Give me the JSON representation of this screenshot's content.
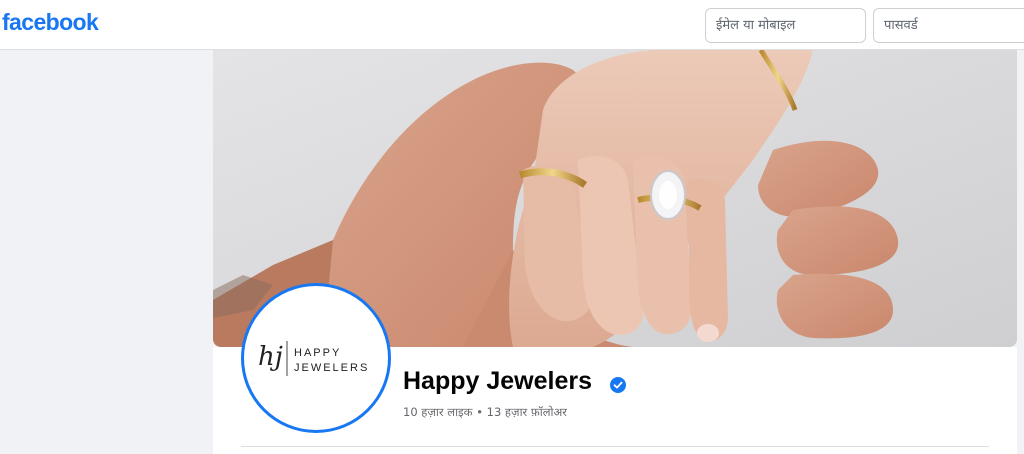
{
  "header": {
    "logo_text": "facebook",
    "email_placeholder": "ईमेल या मोबाइल",
    "password_placeholder": "पासवर्ड",
    "brand_color": "#1877f2"
  },
  "cover": {
    "image": "cover-photo"
  },
  "profile": {
    "avatar_logo_monogram": "hj",
    "avatar_logo_line1": "HAPPY",
    "avatar_logo_line2": "JEWELERS",
    "name": "Happy Jewelers",
    "verified_icon": "verified-badge-icon",
    "likes": "10 हज़ार लाइक",
    "separator": "•",
    "followers": "13 हज़ार फ़ॉलोअर"
  }
}
